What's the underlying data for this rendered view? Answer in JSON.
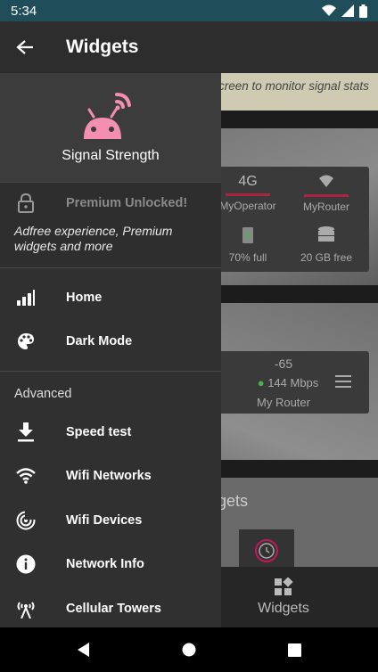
{
  "status_bar": {
    "time": "5:34"
  },
  "app_bar": {
    "title": "Widgets"
  },
  "background": {
    "banner_text": "creen to monitor signal stats",
    "widget1": {
      "cells": [
        {
          "value": "4G",
          "label": "MyOperator"
        },
        {
          "value": "",
          "label": "MyRouter"
        },
        {
          "value": "",
          "label": "70% full"
        },
        {
          "value": "",
          "label": "20 GB free"
        }
      ]
    },
    "widget2": {
      "signal": "-65",
      "speed": "144 Mbps",
      "name": "My Router"
    },
    "card3_title": "lgets",
    "bottom_nav_label": "Widgets"
  },
  "drawer": {
    "app_name": "Signal Strength",
    "premium_title": "Premium Unlocked!",
    "premium_desc": "Adfree experience, Premium widgets and more",
    "items": [
      {
        "label": "Home",
        "icon": "signal-bars-icon"
      },
      {
        "label": "Dark Mode",
        "icon": "palette-icon"
      }
    ],
    "advanced_title": "Advanced",
    "advanced_items": [
      {
        "label": "Speed test",
        "icon": "download-icon"
      },
      {
        "label": "Wifi Networks",
        "icon": "wifi-icon"
      },
      {
        "label": "Wifi Devices",
        "icon": "wifi-devices-icon"
      },
      {
        "label": "Network Info",
        "icon": "info-icon"
      },
      {
        "label": "Cellular Towers",
        "icon": "cell-tower-icon"
      }
    ]
  },
  "colors": {
    "accent": "#f48fb1",
    "status_bar": "#1f4e5a",
    "drawer": "#303030"
  }
}
